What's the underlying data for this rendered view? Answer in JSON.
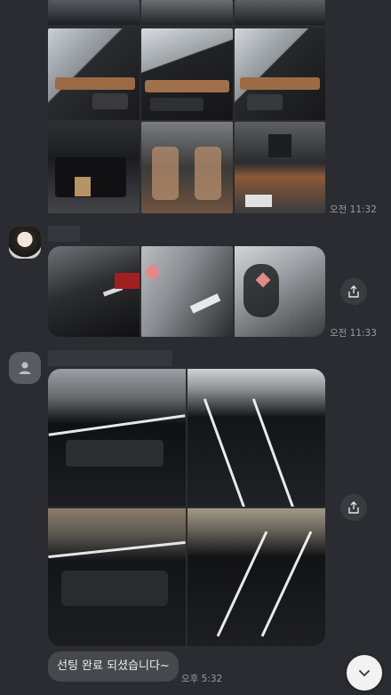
{
  "messages": [
    {
      "grid": "car-interior-grid",
      "time": "오전 11:32",
      "photos": [
        "rear-door-interior",
        "front-door-interior",
        "rear-door-interior-2",
        "open-trunk",
        "seats-covered",
        "dashboard"
      ]
    },
    {
      "grid": "car-badge-grid",
      "time": "오전 11:33",
      "photos": [
        "trunk-emblem",
        "awd-badge",
        "badge-closeup"
      ]
    },
    {
      "grid": "tinted-car-grid",
      "time": "오후 5:32",
      "photos": [
        "side-window-tint",
        "rear-window-tint",
        "side-view-tint",
        "windshield-tint"
      ],
      "text": "선팅 완료 되셨습니다~"
    }
  ],
  "icons": {
    "share": "share-icon",
    "scroll_down": "chevron-down-icon",
    "profile": "person-icon"
  },
  "colors": {
    "background": "#2b2c31",
    "bubble": "#47484d",
    "timestamp": "#9a9ba1"
  }
}
